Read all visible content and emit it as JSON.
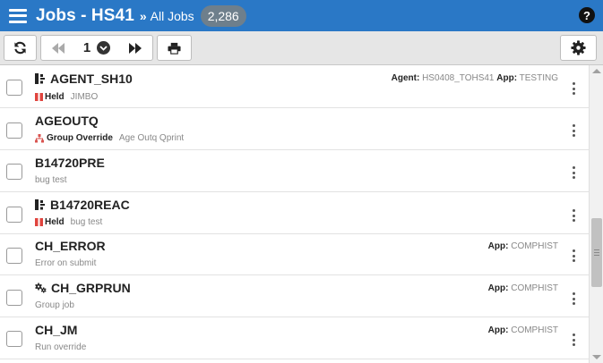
{
  "header": {
    "title": "Jobs - HS41",
    "crumb_separator": "»",
    "breadcrumb": "All Jobs",
    "count": "2,286",
    "help": "?"
  },
  "toolbar": {
    "page": "1"
  },
  "jobs": [
    {
      "name": "AGENT_SH10",
      "icon": "agent-job-icon",
      "status": "Held",
      "desc": "JIMBO",
      "agent_label": "Agent:",
      "agent": "HS0408_TOHS41",
      "app_label": "App:",
      "app": "TESTING"
    },
    {
      "name": "AGEOUTQ",
      "icon": "",
      "status": "Group Override",
      "desc": "Age Outq Qprint"
    },
    {
      "name": "B14720PRE",
      "icon": "",
      "status": "",
      "desc": "bug test"
    },
    {
      "name": "B14720REAC",
      "icon": "agent-job-icon",
      "status": "Held",
      "desc": "bug test"
    },
    {
      "name": "CH_ERROR",
      "icon": "",
      "status": "",
      "desc": "Error on submit",
      "app_label": "App:",
      "app": "COMPHIST"
    },
    {
      "name": "CH_GRPRUN",
      "icon": "gears-icon",
      "status": "",
      "desc": "Group job",
      "app_label": "App:",
      "app": "COMPHIST"
    },
    {
      "name": "CH_JM",
      "icon": "",
      "status": "",
      "desc": "Run override",
      "app_label": "App:",
      "app": "COMPHIST"
    }
  ],
  "colors": {
    "header_bg": "#2a78c6",
    "held": "#e0443e",
    "group_override": "#d9534f"
  }
}
